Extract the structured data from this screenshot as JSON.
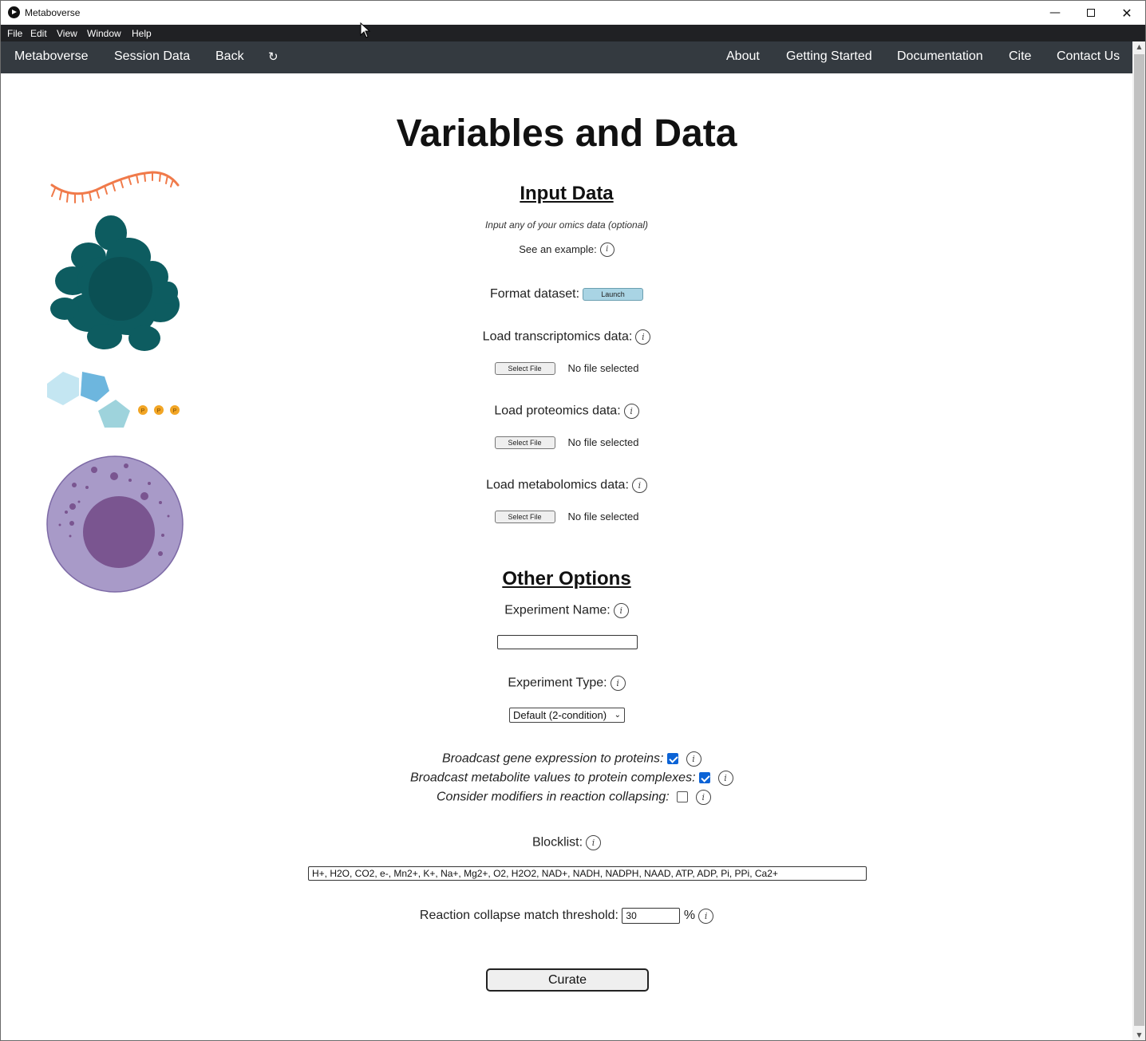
{
  "window": {
    "title": "Metaboverse",
    "minimize_glyph": "—",
    "close_glyph": "✕"
  },
  "menubar": [
    "File",
    "Edit",
    "View",
    "Window",
    "Help"
  ],
  "navbar": {
    "left": [
      "Metaboverse",
      "Session Data",
      "Back",
      "↻"
    ],
    "right": [
      "About",
      "Getting Started",
      "Documentation",
      "Cite",
      "Contact Us"
    ]
  },
  "page": {
    "title": "Variables and Data"
  },
  "input_data": {
    "heading": "Input Data",
    "subtitle": "Input any of your omics data (optional)",
    "example_label": "See an example:",
    "format_label": "Format dataset:",
    "launch_label": "Launch",
    "loaders": [
      {
        "label": "Load transcriptomics data:",
        "button": "Select File",
        "status": "No file selected"
      },
      {
        "label": "Load proteomics data:",
        "button": "Select File",
        "status": "No file selected"
      },
      {
        "label": "Load metabolomics data:",
        "button": "Select File",
        "status": "No file selected"
      }
    ]
  },
  "other_options": {
    "heading": "Other Options",
    "experiment_name_label": "Experiment Name:",
    "experiment_name_value": "",
    "experiment_type_label": "Experiment Type:",
    "experiment_type_value": "Default (2-condition)",
    "checkboxes": [
      {
        "label": "Broadcast gene expression to proteins:",
        "checked": true
      },
      {
        "label": "Broadcast metabolite values to protein complexes:",
        "checked": true
      },
      {
        "label": "Consider modifiers in reaction collapsing:",
        "checked": false
      }
    ],
    "blocklist_label": "Blocklist:",
    "blocklist_value": "H+, H2O, CO2, e-, Mn2+, K+, Na+, Mg2+, O2, H2O2, NAD+, NADH, NADPH, NAAD, ATP, ADP, Pi, PPi, Ca2+",
    "threshold_label": "Reaction collapse match threshold:",
    "threshold_value": "30",
    "threshold_unit": "%",
    "curate_label": "Curate"
  },
  "icons": {
    "info": "i",
    "phosphate": "P"
  },
  "colors": {
    "navbar_bg": "#343a40",
    "menubar_bg": "#202124",
    "launch_bg": "#a9d4e4",
    "checkbox_on": "#0b63d6",
    "rna": "#f07a4a",
    "protein": "#0d5c60",
    "cell_outer": "#a89ac8",
    "cell_nucleus": "#7a5590"
  }
}
